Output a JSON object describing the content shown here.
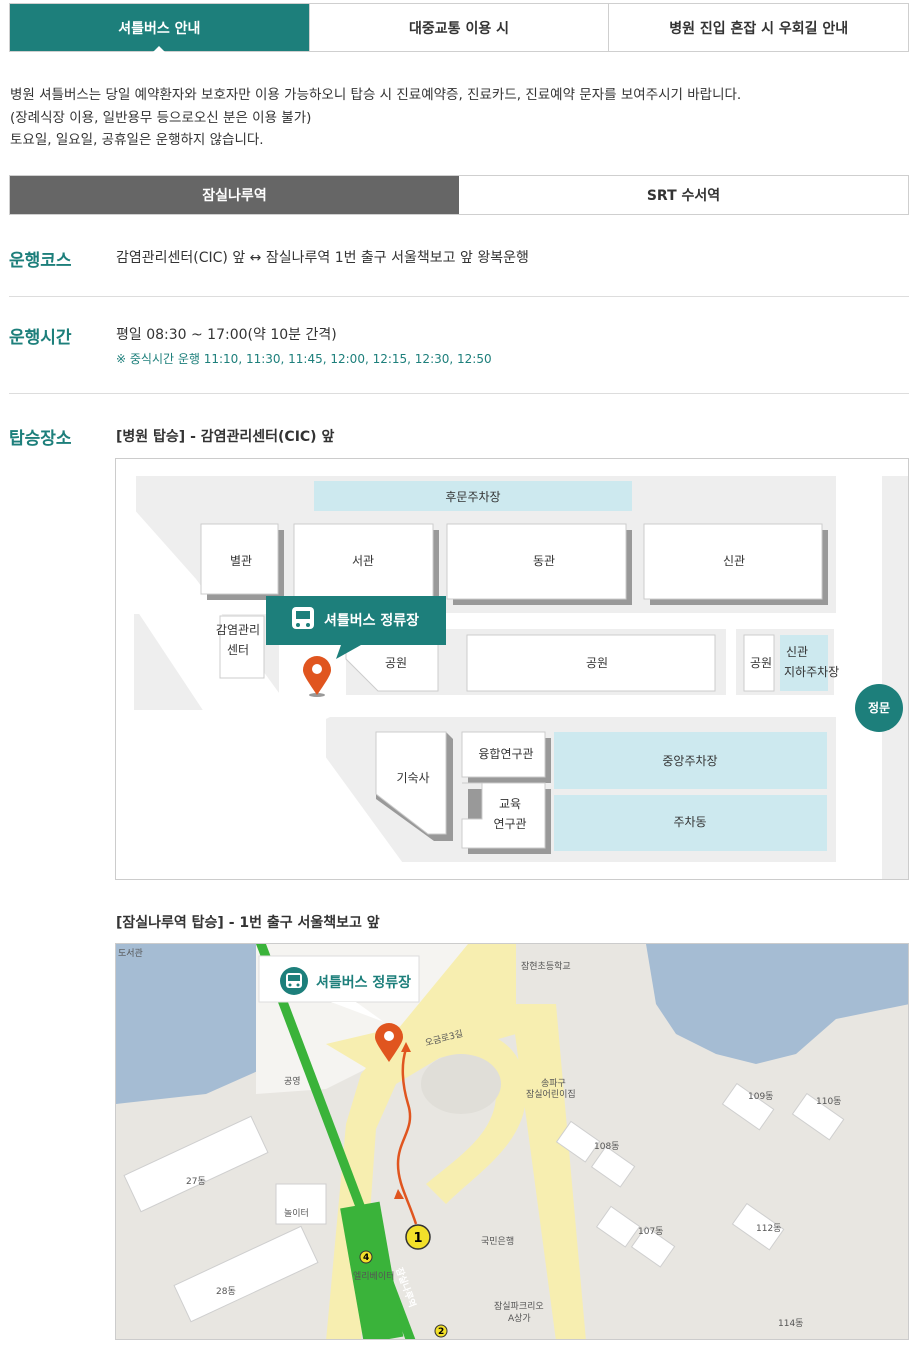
{
  "top_tabs": [
    "셔틀버스 안내",
    "대중교통 이용 시",
    "병원 진입 혼잡 시 우회길 안내"
  ],
  "intro": {
    "line1": "병원 셔틀버스는 당일 예약환자와 보호자만 이용 가능하오니 탑승 시 진료예약증, 진료카드, 진료예약 문자를 보여주시기 바랍니다.",
    "line2": "(장례식장 이용, 일반용무 등으로오신 분은 이용 불가)",
    "line3": "토요일, 일요일, 공휴일은 운행하지 않습니다."
  },
  "sub_tabs": [
    "잠실나루역",
    "SRT 수서역"
  ],
  "course": {
    "label": "운행코스",
    "text": "감염관리센터(CIC) 앞 ↔ 잠실나루역 1번 출구 서울책보고 앞 왕복운행"
  },
  "schedule": {
    "label": "운행시간",
    "text": "평일 08:30 ~ 17:00(약 10분 간격)",
    "note": "※ 중식시간 운행 11:10, 11:30, 11:45, 12:00, 12:15, 12:30, 12:50"
  },
  "boarding": {
    "label": "탑승장소",
    "hospital_caption": "[병원 탑승] - 감염관리센터(CIC) 앞",
    "station_caption": "[잠실나루역 탑승] - 1번 출구 서울책보고 앞"
  },
  "map1": {
    "stop_label": "셔틀버스 정류장",
    "buildings": {
      "rear_parking": "후문주차장",
      "annex": "별관",
      "west": "서관",
      "east": "동관",
      "new": "신관",
      "cic_line1": "감염관리",
      "cic_line2": "센터",
      "park1": "공원",
      "park2": "공원",
      "park3": "공원",
      "new_ug_line1": "신관",
      "new_ug_line2": "지하주차장",
      "main_gate": "정문",
      "dorm": "기숙사",
      "research": "융합연구관",
      "edu_line1": "교육",
      "edu_line2": "연구관",
      "central_parking": "중앙주차장",
      "parking_bldg": "주차동"
    }
  },
  "map2": {
    "stop_label": "셔틀버스 정류장",
    "labels": {
      "library": "도서관",
      "school": "잠현초등학교",
      "road": "오금로3길",
      "public": "공영",
      "kindergarten_line1": "송파구",
      "kindergarten_line2": "잠실어린이집",
      "playground": "놀이터",
      "bank": "국민은행",
      "elevator": "엘리베이터",
      "station": "잠실나루역",
      "mall_line1": "잠실파크리오",
      "mall_line2": "A상가",
      "exit1": "1",
      "exit2": "2",
      "exit4": "4",
      "b108": "108동",
      "b109": "109동",
      "b110": "110동",
      "b107": "107동",
      "b112": "112동",
      "b114": "114동",
      "b27": "27동",
      "b28": "28동"
    }
  },
  "colors": {
    "accent": "#1d7f7b",
    "pin": "#e0551f",
    "parking_fill": "#cde9ef",
    "subway_line": "#3ab33a"
  }
}
